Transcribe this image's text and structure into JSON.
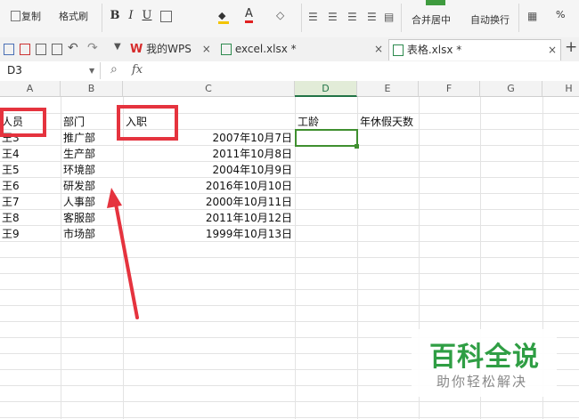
{
  "ribbon": {
    "copy_label": "复制",
    "format_painter_label": "格式刷",
    "bold": "B",
    "italic": "I",
    "underline": "U",
    "merge_center_label": "合并居中",
    "wrap_text_label": "自动换行",
    "percent": "%"
  },
  "tabs": [
    {
      "label": "我的WPS"
    },
    {
      "label": "excel.xlsx *"
    },
    {
      "label": "表格.xlsx *"
    }
  ],
  "formula_bar": {
    "cell_ref": "D3",
    "fx": "fx"
  },
  "columns": [
    "A",
    "B",
    "C",
    "D",
    "E",
    "F",
    "G",
    "H"
  ],
  "headers": {
    "a": "人员",
    "b": "部门",
    "c": "入职",
    "d": "工龄",
    "e": "年休假天数"
  },
  "rows": [
    {
      "a": "王3",
      "b": "推广部",
      "c": "2007年10月7日"
    },
    {
      "a": "王4",
      "b": "生产部",
      "c": "2011年10月8日"
    },
    {
      "a": "王5",
      "b": "环境部",
      "c": "2004年10月9日"
    },
    {
      "a": "王6",
      "b": "研发部",
      "c": "2016年10月10日"
    },
    {
      "a": "王7",
      "b": "人事部",
      "c": "2000年10月11日"
    },
    {
      "a": "王8",
      "b": "客服部",
      "c": "2011年10月12日"
    },
    {
      "a": "王9",
      "b": "市场部",
      "c": "1999年10月13日"
    }
  ],
  "watermark": {
    "title": "百科全说",
    "subtitle": "助你轻松解决"
  },
  "colors": {
    "highlight": "#e5333e",
    "selection": "#3f8f2f",
    "watermark_green": "#2f9e44"
  }
}
